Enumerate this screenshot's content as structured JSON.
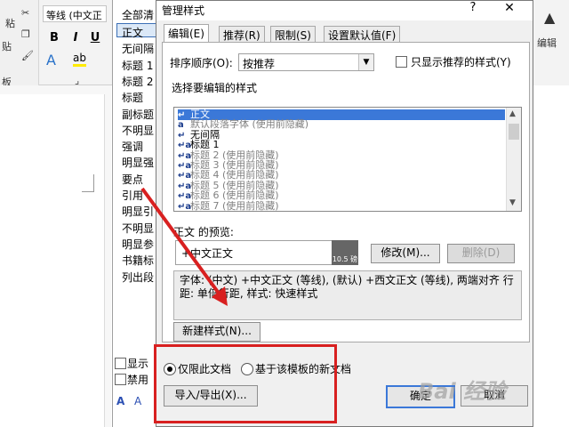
{
  "word": {
    "font_name": "等线 (中文正",
    "ribbon_left_labels": [
      "粘",
      "贴",
      "板"
    ],
    "paste_label": "贴",
    "clipboard_label": "板",
    "format_buttons": [
      "B",
      "I",
      "U"
    ],
    "right_label": "编辑"
  },
  "styles_pane": {
    "clear_all": "全部清",
    "items": [
      "正文",
      "无间隔",
      "标题 1",
      "标题 2",
      "标题",
      "副标题",
      "不明显",
      "强调",
      "明显强",
      "要点",
      "引用",
      "明显引",
      "不明显",
      "明显参",
      "书籍标",
      "列出段"
    ],
    "show_preview": "显示",
    "disable_linked": "禁用"
  },
  "dialog": {
    "title": "管理样式",
    "help": "?",
    "close": "✕",
    "tabs": [
      "编辑(E)",
      "推荐(R)",
      "限制(S)",
      "设置默认值(F)"
    ],
    "sort_label": "排序顺序(O):",
    "sort_value": "按推荐",
    "only_recommended": "只显示推荐的样式(Y)",
    "select_label": "选择要编辑的样式",
    "style_list": [
      {
        "icon": "↵",
        "name": "正文",
        "selected": true
      },
      {
        "icon": "a",
        "name": "默认段落字体  (使用前隐藏)",
        "selected": false
      },
      {
        "icon": "↵",
        "name": "无间隔",
        "selected": false
      },
      {
        "icon": "↵a",
        "name": "标题 1",
        "selected": false
      },
      {
        "icon": "↵a",
        "name": "标题 2  (使用前隐藏)",
        "selected": false
      },
      {
        "icon": "↵a",
        "name": "标题 3  (使用前隐藏)",
        "selected": false
      },
      {
        "icon": "↵a",
        "name": "标题 4  (使用前隐藏)",
        "selected": false
      },
      {
        "icon": "↵a",
        "name": "标题 5  (使用前隐藏)",
        "selected": false
      },
      {
        "icon": "↵a",
        "name": "标题 6  (使用前隐藏)",
        "selected": false
      },
      {
        "icon": "↵a",
        "name": "标题 7  (使用前隐藏)",
        "selected": false
      }
    ],
    "preview_label": "正文 的预览:",
    "preview_text": "+中文正文",
    "preview_size": "10.5 磅",
    "modify_button": "修改(M)...",
    "delete_button": "删除(D)",
    "description": "字体: (中文) +中文正文 (等线), (默认) +西文正文 (等线), 两端对齐 行距: 单倍行距, 样式: 快速样式",
    "new_style_button": "新建样式(N)...",
    "radio_this_doc": "仅限此文档",
    "radio_template": "基于该模板的新文档",
    "import_export_button": "导入/导出(X)...",
    "ok_button": "确定",
    "cancel_button": "取消"
  },
  "watermark": "Bai 经验",
  "colors": {
    "annotation": "#d82020",
    "selection": "#3b78d8"
  }
}
